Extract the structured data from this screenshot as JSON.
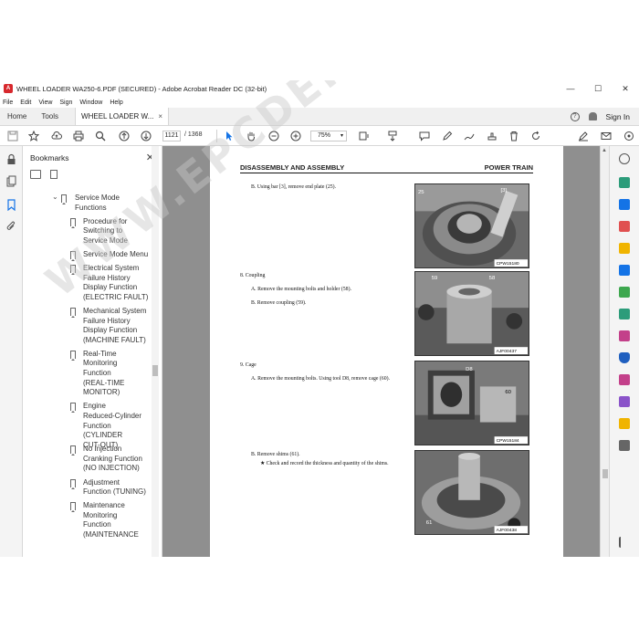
{
  "window": {
    "title": "WHEEL LOADER WA250-6.PDF (SECURED) - Adobe Acrobat Reader DC (32-bit)",
    "controls": {
      "minimize": "—",
      "maximize": "☐",
      "close": "✕"
    }
  },
  "menu": [
    "File",
    "Edit",
    "View",
    "Sign",
    "Window",
    "Help"
  ],
  "tabs": {
    "home": "Home",
    "tools": "Tools",
    "document": "WHEEL LOADER W...",
    "close": "×",
    "sign_in": "Sign In",
    "help_glyph": "?"
  },
  "toolbar": {
    "current_page": "1121",
    "page_total": "/ 1368",
    "zoom": "75%",
    "zoom_caret": "▾"
  },
  "bookmarks": {
    "title": "Bookmarks",
    "close": "✕",
    "items": [
      {
        "label": "Service Mode Functions",
        "lines": [
          "Service Mode",
          "Functions"
        ],
        "expanded": true
      },
      {
        "label": "Procedure for Switching to Service Mode",
        "lines": [
          "Procedure for",
          "Switching to",
          "Service Mode"
        ]
      },
      {
        "label": "Service Mode Menu",
        "lines": [
          "Service Mode Menu"
        ]
      },
      {
        "label": "Electrical System Failure History Display Function (ELECTRIC FAULT)",
        "lines": [
          "Electrical System",
          "Failure History",
          "Display Function",
          "(ELECTRIC FAULT)"
        ]
      },
      {
        "label": "Mechanical System Failure History Display Function (MACHINE FAULT)",
        "lines": [
          "Mechanical System",
          "Failure History",
          "Display Function",
          "(MACHINE FAULT)"
        ]
      },
      {
        "label": "Real-Time Monitoring Function (REAL-TIME MONITOR)",
        "lines": [
          "Real-Time",
          "Monitoring",
          "Function",
          "(REAL-TIME",
          "MONITOR)"
        ]
      },
      {
        "label": "Engine Reduced-Cylinder Function (CYLINDER CUT-OUT)",
        "lines": [
          "Engine",
          "Reduced-Cylinder",
          "Function (CYLINDER",
          "CUT-OUT)"
        ]
      },
      {
        "label": "No Injection Cranking Function (NO INJECTION)",
        "lines": [
          "No Injection",
          "Cranking Function",
          "(NO INJECTION)"
        ]
      },
      {
        "label": "Adjustment Function (TUNING)",
        "lines": [
          "Adjustment",
          "Function (TUNING)"
        ]
      },
      {
        "label": "Maintenance Monitoring Function (MAINTENANCE",
        "lines": [
          "Maintenance",
          "Monitoring",
          "Function",
          "(MAINTENANCE"
        ]
      }
    ]
  },
  "page": {
    "header_left": "DISASSEMBLY AND ASSEMBLY",
    "header_right": "POWER TRAIN",
    "steps": [
      {
        "text": "B.   Using bar [3], remove end plate (25)."
      },
      {
        "text": "8.   Coupling"
      },
      {
        "text": "A.   Remove the mounting bolts and holder (58)."
      },
      {
        "text": "B.   Remove coupling (59)."
      },
      {
        "text": "9.   Cage"
      },
      {
        "text": "A.   Remove the mounting bolts. Using tool D8, remove cage (60)."
      },
      {
        "text": "B.   Remove shims (61)."
      },
      {
        "text": "★   Check and record the thickness and quantity of the shims."
      }
    ],
    "photos": [
      {
        "callouts": [
          "25",
          "[3]"
        ],
        "code": "CPW15180"
      },
      {
        "callouts": [
          "59",
          "58"
        ],
        "code": "AJF00437"
      },
      {
        "callouts": [
          "D8",
          "60"
        ],
        "code": "CPW15184"
      },
      {
        "callouts": [
          "61"
        ],
        "code": "AJF00438"
      }
    ],
    "watermark": "WWW.EPCDEPOT.COM"
  }
}
